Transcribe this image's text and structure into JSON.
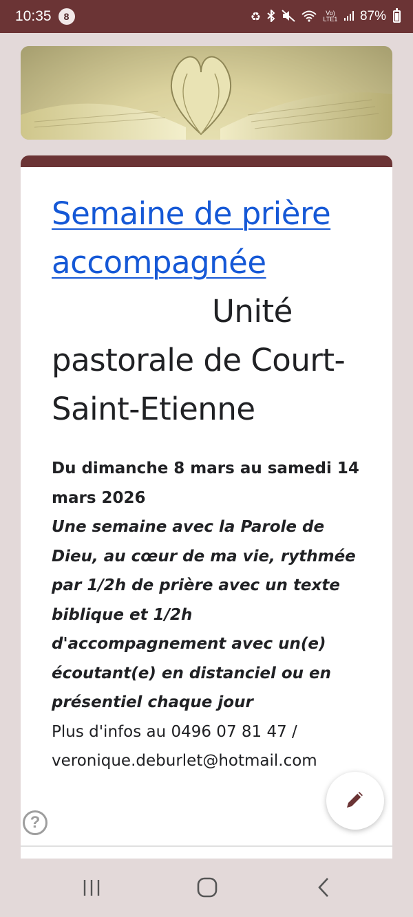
{
  "status_bar": {
    "time": "10:35",
    "notification_count": "8",
    "network_label": "Vo) LTE1",
    "battery": "87%"
  },
  "post": {
    "title_link": "Semaine de prière accompagnée ",
    "title_rest": "Unité pastorale de Court-Saint-Etienne",
    "dates": "Du dimanche 8 mars au samedi 14 mars 2026",
    "description": "Une semaine avec la Parole de Dieu, au cœur de ma vie, rythmée par 1/2h de prière avec un texte biblique et 1/2h d'accompagnement avec un(e) écoutant(e) en distanciel ou en présentiel chaque jour",
    "contact_line1": "Plus d'infos au 0496 07 81 47 /",
    "contact_line2": "veronique.deburlet@hotmail.com"
  },
  "icons": {
    "fab": "pencil-icon",
    "help": "question-mark-icon",
    "nav_recents": "recents-icon",
    "nav_home": "home-icon",
    "nav_back": "back-icon"
  },
  "help_glyph": "?",
  "colors": {
    "accent": "#6b3435",
    "link": "#1558d6",
    "background": "#e3d9d9"
  }
}
